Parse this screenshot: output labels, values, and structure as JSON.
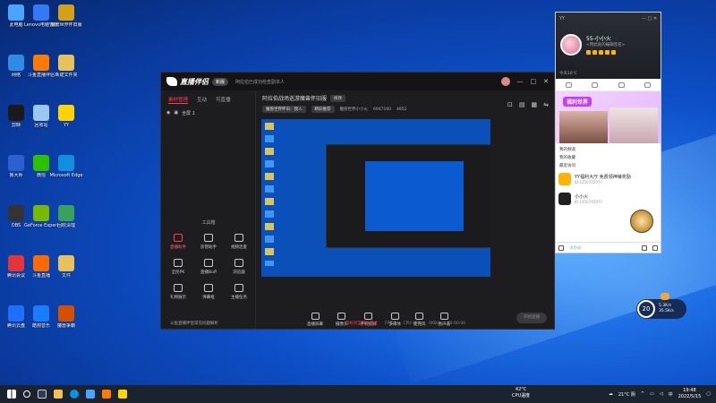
{
  "desktop": {
    "icons": [
      {
        "label": "此电脑",
        "color": "#4aa3ff"
      },
      {
        "label": "Lenovo电脑管家",
        "color": "#3478f6"
      },
      {
        "label": "魔兽世界怀旧服",
        "color": "#d4a017"
      },
      {
        "label": "网络",
        "color": "#2f8be6"
      },
      {
        "label": "斗鱼直播伴侣",
        "color": "#ff7a00"
      },
      {
        "label": "新建文件夹",
        "color": "#e8c15a"
      },
      {
        "label": "剪映",
        "color": "#1a1a1a"
      },
      {
        "label": "回收站",
        "color": "#9cc7ef"
      },
      {
        "label": "YY",
        "color": "#ffd400"
      },
      {
        "label": "鲁大师",
        "color": "#2d5fd1"
      },
      {
        "label": "微信",
        "color": "#2dc100"
      },
      {
        "label": "Microsoft Edge",
        "color": "#0f8fe0"
      },
      {
        "label": "OBS",
        "color": "#333333"
      },
      {
        "label": "GeForce Experience",
        "color": "#76b900"
      },
      {
        "label": "回收清理",
        "color": "#3aa05a"
      },
      {
        "label": "腾讯会议",
        "color": "#e4343a"
      },
      {
        "label": "斗鱼直播",
        "color": "#ff6a00"
      },
      {
        "label": "文件",
        "color": "#e8c15a"
      },
      {
        "label": "腾讯云盘",
        "color": "#1e6fff"
      },
      {
        "label": "酷狗音乐",
        "color": "#1a7cff"
      },
      {
        "label": "魔兽争霸",
        "color": "#d45000"
      }
    ]
  },
  "app": {
    "title": "直播伴侣",
    "version_badge": "新版",
    "notice": "阿拉伯已成功检查副本人",
    "window_controls": [
      "—",
      "□",
      "✕"
    ],
    "side_tabs": [
      "素材管理",
      "互动",
      "可直播"
    ],
    "scene_label": "全屏 1",
    "tools_title": "工具箱",
    "tools": [
      {
        "label": "直播助手",
        "active": true
      },
      {
        "label": "房管助手",
        "active": false
      },
      {
        "label": "视频连麦",
        "active": false
      },
      {
        "label": "全民PK",
        "active": false
      },
      {
        "label": "直播Buff",
        "active": false
      },
      {
        "label": "浏览器",
        "active": false
      },
      {
        "label": "礼物展示",
        "active": false
      },
      {
        "label": "弹幕框",
        "active": false
      },
      {
        "label": "主播任务",
        "active": false
      }
    ],
    "side_footer": "斗鱼直播伴侣常见问题解析",
    "room": {
      "title": "阿拉伯战场巡游魔兽怀旧服",
      "edit_btn": "修改",
      "category": "魔兽世界怀旧：我人",
      "share_btn": "精彩推荐",
      "room_id": "魔兽世界小小火",
      "fans": "6947160",
      "hot": "4852"
    },
    "controls": [
      "直播屏幕",
      "摄像头",
      "手机投屏",
      "多媒体",
      "麦克风",
      "扬声器"
    ],
    "start_live": "开始直播",
    "status": {
      "warn": "高校机型默认模式",
      "fps": "FPS:0",
      "cpu": "CPU:40%",
      "net": "0KB/s",
      "time": "00:00:00"
    }
  },
  "qq": {
    "brand": "YY",
    "name": "55-小小火",
    "signature": "<用此处的编辑签名>",
    "weather": "今天16℃",
    "banner_text": "福利世界",
    "rows": [
      "我的频道",
      "我的收藏",
      "最近访问"
    ],
    "chats": [
      {
        "name": "YY福利大厅 免费领神壕奖励",
        "sub": "ID 1450745977",
        "color": "#ffb400"
      },
      {
        "name": "小小火",
        "sub": "ID 1450745977",
        "color": "#222222"
      }
    ],
    "footer_tab": "小小火"
  },
  "speed_widget": {
    "percent": "20",
    "up": "5.3K/s",
    "down": "35.5K/s"
  },
  "taskbar": {
    "temperature": "42°C",
    "temperature_label": "CPU温度",
    "weather": "21°C 阴",
    "time": "19:48",
    "date": "2022/5/15",
    "language": "中"
  }
}
